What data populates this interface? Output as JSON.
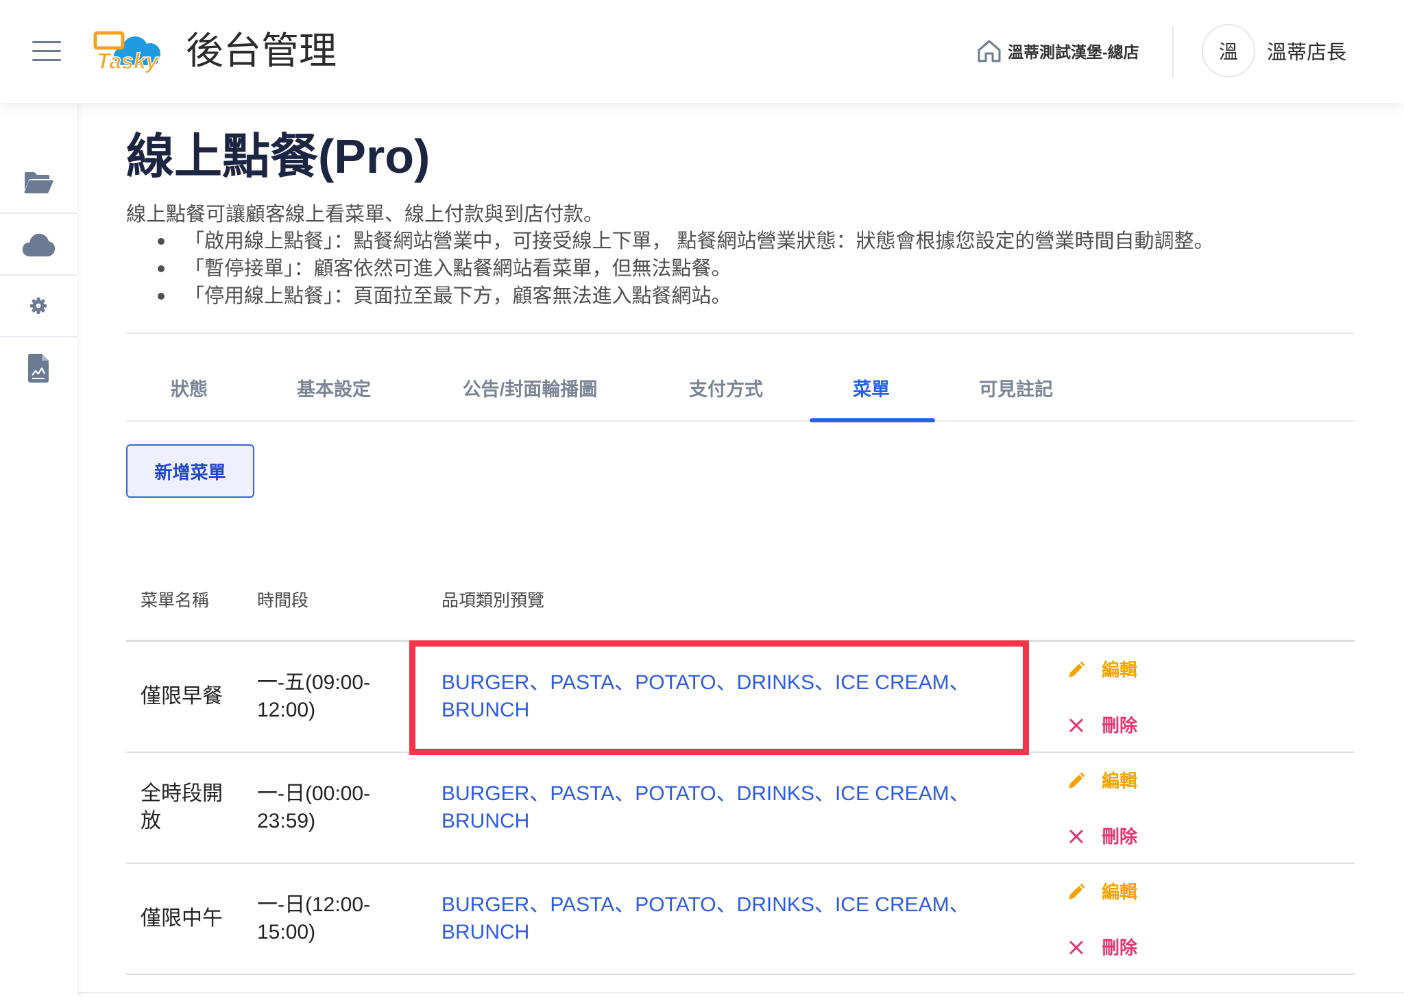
{
  "header": {
    "menu_icon": "hamburger-menu-icon",
    "logo_text": "Tasky",
    "title": "後台管理",
    "store_icon": "home-icon",
    "store_name": "溫蒂測試漢堡-總店",
    "avatar_initial": "溫",
    "user_name": "溫蒂店長"
  },
  "sidebar": {
    "items": [
      {
        "icon": "folder-open-icon"
      },
      {
        "icon": "cloud-icon"
      },
      {
        "icon": "gear-icon"
      },
      {
        "icon": "report-document-icon"
      }
    ]
  },
  "page": {
    "title": "線上點餐(Pro)",
    "description": "線上點餐可讓顧客線上看菜單、線上付款與到店付款。",
    "bullets": [
      "「啟用線上點餐」：點餐網站營業中，可接受線上下單， 點餐網站營業狀態：狀態會根據您設定的營業時間自動調整。",
      "「暫停接單」：顧客依然可進入點餐網站看菜單，但無法點餐。",
      "「停用線上點餐」：頁面拉至最下方，顧客無法進入點餐網站。"
    ]
  },
  "tabs": {
    "items": [
      {
        "label": "狀態"
      },
      {
        "label": "基本設定"
      },
      {
        "label": "公告/封面輪播圖"
      },
      {
        "label": "支付方式"
      },
      {
        "label": "菜單"
      },
      {
        "label": "可見註記"
      }
    ],
    "active": "菜單"
  },
  "add_menu_button": {
    "label": "新增菜單"
  },
  "table": {
    "headers": {
      "name": "菜單名稱",
      "time": "時間段",
      "categories": "品項類別預覽"
    },
    "rows": [
      {
        "name": "僅限早餐",
        "time": "一-五(09:00-12:00)",
        "categories": "BURGER、PASTA、POTATO、DRINKS、ICE CREAM、BRUNCH"
      },
      {
        "name": "全時段開放",
        "time": "一-日(00:00-23:59)",
        "categories": "BURGER、PASTA、POTATO、DRINKS、ICE CREAM、BRUNCH"
      },
      {
        "name": "僅限中午",
        "time": "一-日(12:00-15:00)",
        "categories": "BURGER、PASTA、POTATO、DRINKS、ICE CREAM、BRUNCH"
      }
    ],
    "actions": {
      "edit_label": "編輯",
      "edit_icon": "pencil-icon",
      "delete_label": "刪除",
      "delete_icon": "close-x-icon"
    }
  },
  "colors": {
    "primary": "#2563eb",
    "icon": "#6b7b93",
    "edit": "#f5a300",
    "delete": "#e8336e",
    "highlight": "#f4344a",
    "category_link": "#2c5be6"
  }
}
